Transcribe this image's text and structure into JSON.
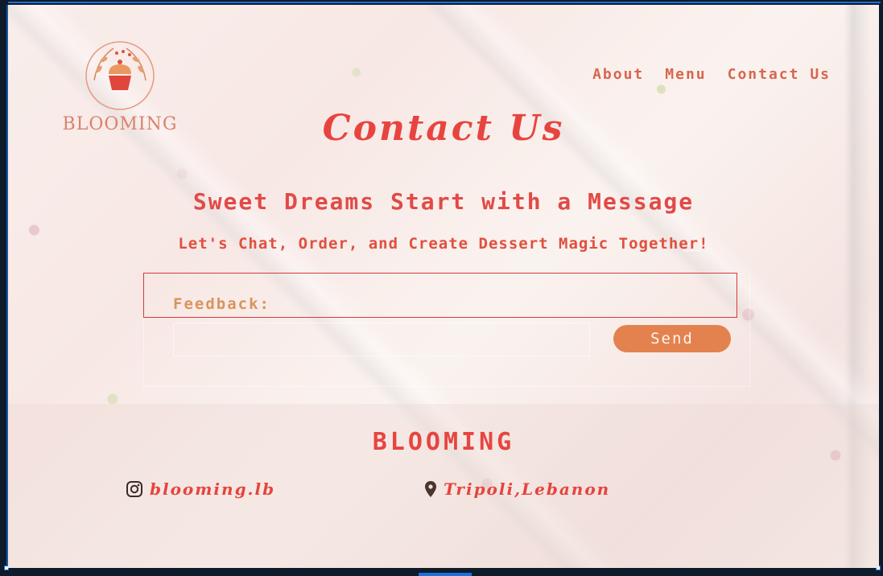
{
  "brand": {
    "name": "BLOOMING"
  },
  "nav": {
    "items": [
      {
        "label": "About"
      },
      {
        "label": "Menu"
      },
      {
        "label": "Contact Us"
      }
    ]
  },
  "page": {
    "title": "Contact Us",
    "headline": "Sweet Dreams Start with a Message",
    "subheadline": "Let's Chat, Order, and Create Dessert Magic Together!"
  },
  "form": {
    "feedback_label": "Feedback:",
    "feedback_value": "",
    "send_label": "Send"
  },
  "footer": {
    "title": "BLOOMING",
    "instagram_handle": "blooming.lb",
    "location": "Tripoli,Lebanon"
  },
  "icons": {
    "instagram": "instagram-icon",
    "location": "map-pin-icon"
  },
  "colors": {
    "accent": "#e8443f",
    "button": "#e3824f",
    "label": "#d8955d",
    "nav": "#d7664f"
  }
}
